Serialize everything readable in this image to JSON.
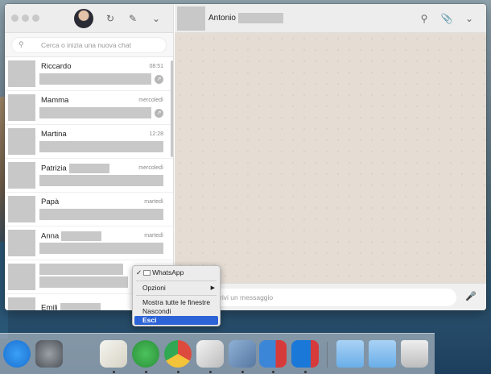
{
  "sidebar": {
    "search_placeholder": "Cerca o inizia una nuova chat",
    "chats": [
      {
        "name": "Riccardo",
        "time": "08:51",
        "pinned": true
      },
      {
        "name": "Mamma",
        "time": "mercoledì",
        "pinned": true
      },
      {
        "name": "Martina",
        "time": "12:28",
        "pinned": false
      },
      {
        "name": "Patrizia",
        "time": "mercoledì",
        "pinned": false
      },
      {
        "name": "Papà",
        "time": "martedì",
        "pinned": false
      },
      {
        "name": "Anna",
        "time": "martedì",
        "pinned": false
      },
      {
        "name": "",
        "time": "",
        "pinned": false
      },
      {
        "name": "Emili",
        "time": "",
        "pinned": false
      }
    ]
  },
  "conversation": {
    "contact_name": "Antonio",
    "compose_placeholder": "rivi un messaggio"
  },
  "context_menu": {
    "items": [
      "WhatsApp",
      "Opzioni",
      "Mostra tutte le finestre",
      "Nascondi",
      "Esci"
    ],
    "checked": "WhatsApp",
    "selected": "Esci"
  },
  "icons": {
    "header": [
      "refresh-icon",
      "compose-icon",
      "chevron-down-icon"
    ],
    "conversation": [
      "search-icon",
      "attach-icon",
      "chevron-down-icon",
      "mic-icon"
    ],
    "dock": [
      "app-store-icon",
      "system-preferences-icon",
      "textedit-icon",
      "whatsapp-icon",
      "chrome-icon",
      "pixelmator-icon",
      "preview-icon",
      "parallels-icon",
      "windows-icon",
      "folder-icon",
      "downloads-folder-icon",
      "trash-icon"
    ]
  },
  "colors": {
    "accent": "#2c63d7",
    "whatsapp": "#3aa14a",
    "chat_bg": "#e5ddd4"
  }
}
